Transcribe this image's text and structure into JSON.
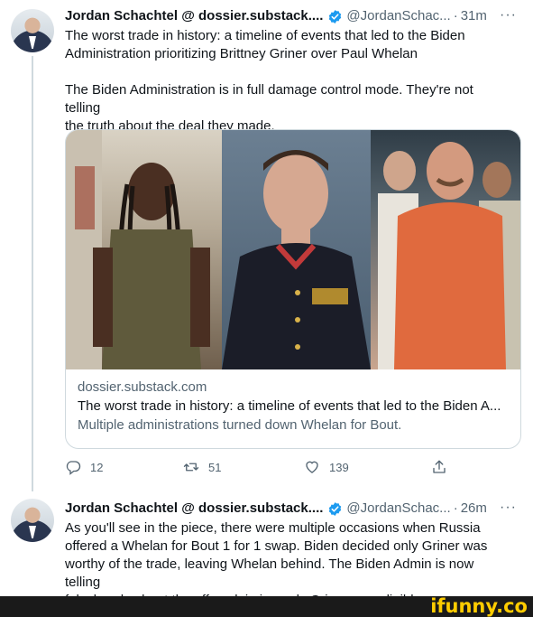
{
  "tweets": [
    {
      "name": "Jordan Schachtel @ dossier.substack....",
      "handle": "@JordanSchac...",
      "separator": "·",
      "time": "31m",
      "more": "···",
      "text_line1": "The worst trade in history: a timeline of events that led to the Biden",
      "text_line2": "Administration prioritizing Brittney Griner over Paul Whelan",
      "text_line3": "The Biden Administration is in full damage control mode. They're not telling",
      "text_line4": "the truth about the deal they made.",
      "card": {
        "domain": "dossier.substack.com",
        "title": "The worst trade in history: a timeline of events that led to the Biden A...",
        "description": "Multiple administrations turned down Whelan for Bout."
      },
      "actions": {
        "replies": "12",
        "retweets": "51",
        "likes": "139"
      }
    },
    {
      "name": "Jordan Schachtel @ dossier.substack....",
      "handle": "@JordanSchac...",
      "separator": "·",
      "time": "26m",
      "more": "···",
      "text_line1": "As you'll see in the piece, there were multiple occasions when Russia",
      "text_line2": "offered a Whelan for Bout 1 for 1 swap. Biden decided only Griner was",
      "text_line3": "worthy of the trade, leaving Whelan behind. The Biden Admin is now telling",
      "text_line4": "falsehoods about the offer, claiming only Griner was eligible."
    }
  ],
  "watermark": "ifunny.co",
  "colors": {
    "verified": "#1d9bf0",
    "secondary_text": "#536471",
    "watermark": "#ffcc00"
  }
}
